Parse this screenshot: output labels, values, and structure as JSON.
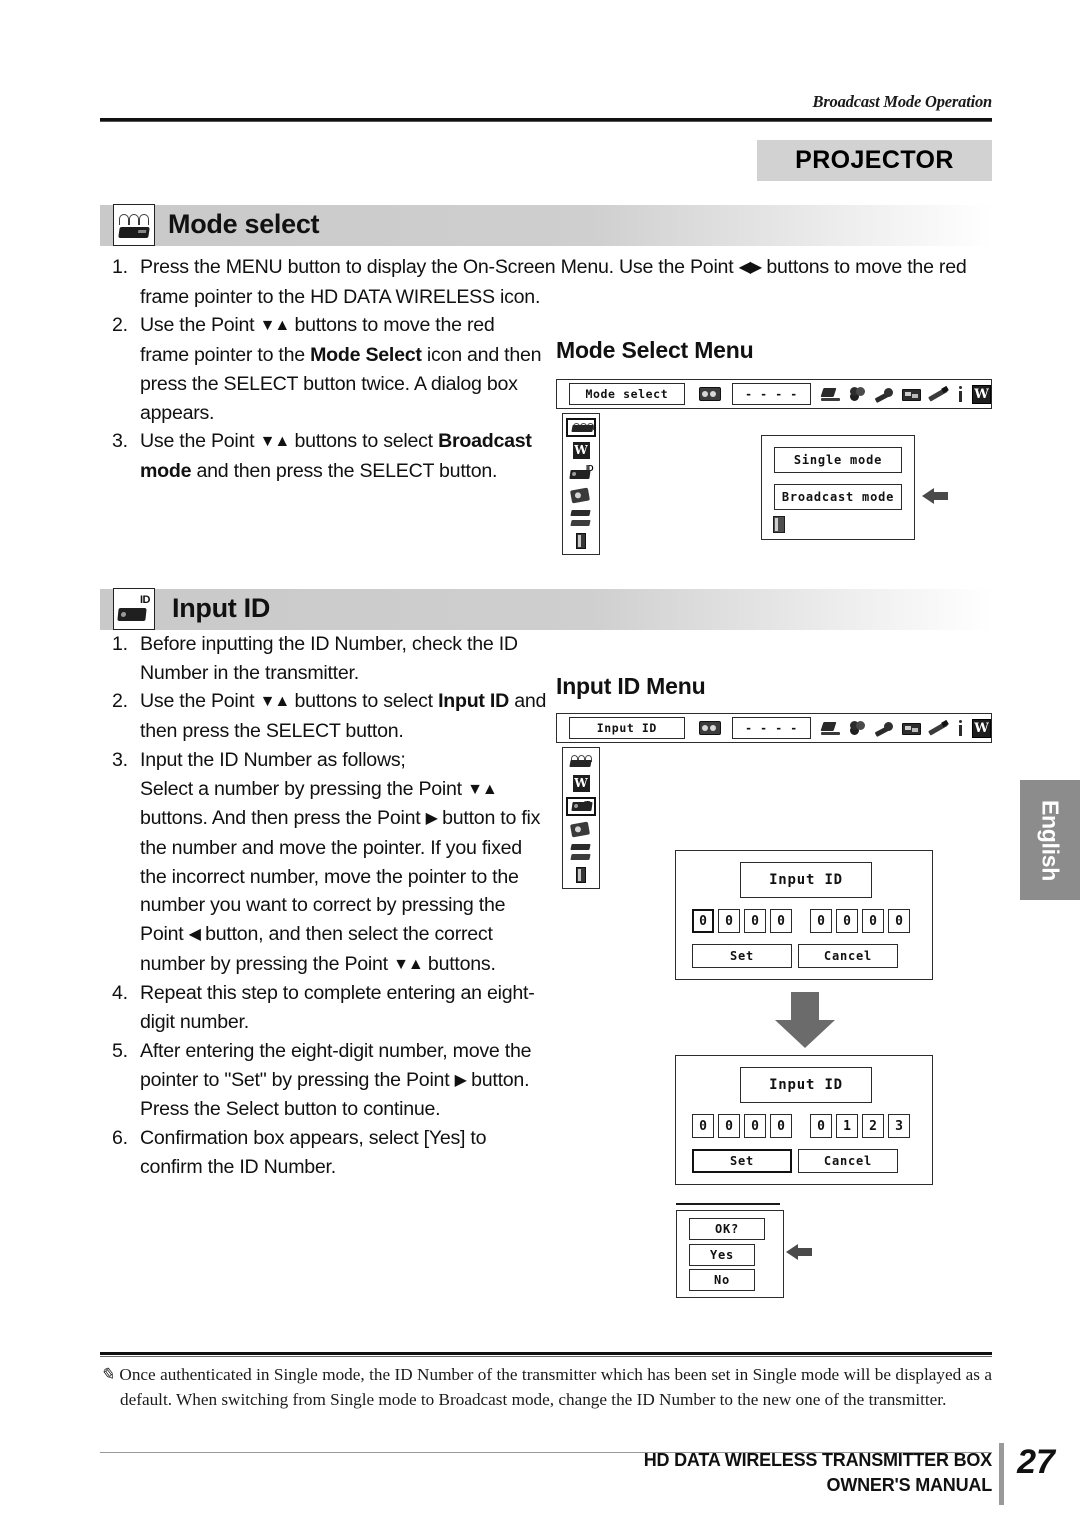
{
  "running_head": "Broadcast Mode Operation",
  "projector_tag": "PROJECTOR",
  "sections": [
    {
      "id": "mode-select",
      "icon": "wireless-transmitter-icon",
      "title": "Mode select",
      "steps": [
        {
          "num": "1.",
          "text": "Press the MENU button to display the On-Screen Menu. Use the Point ◀▶ buttons to move the red frame pointer to the HD DATA WIRELESS icon."
        },
        {
          "num": "2.",
          "text": "Use the Point ▼▲ buttons to move the red frame pointer to the Mode Select icon and then press the SELECT button twice. A dialog box appears."
        },
        {
          "num": "3.",
          "text": "Use the Point ▼▲ buttons to select Broadcast mode and then press the SELECT button."
        }
      ]
    },
    {
      "id": "input-id",
      "icon": "id-projector-icon",
      "title": "Input ID",
      "steps": [
        {
          "num": "1.",
          "text": "Before inputting the ID Number, check the ID Number in the transmitter."
        },
        {
          "num": "2.",
          "text": "Use the Point ▼▲ buttons to select Input ID and then press the SELECT button."
        },
        {
          "num": "3.",
          "text": "Input the ID Number as follows;"
        },
        {
          "num": "",
          "text": "Select a number by pressing the Point ▼▲ buttons. And then press the Point ▶ button to fix the number and move the pointer. If you fixed the incorrect number, move the pointer to the number you want to correct by pressing the Point ◀ button, and then select the correct number by pressing the Point ▼▲ buttons."
        },
        {
          "num": "4.",
          "text": "Repeat this step to complete entering an eight-digit number."
        },
        {
          "num": "5.",
          "text": "After entering the eight-digit number, move the pointer to \"Set\" by pressing the Point ▶ button. Press the Select button to continue."
        },
        {
          "num": "6.",
          "text": "Confirmation box appears, select [Yes] to confirm the ID Number."
        }
      ]
    }
  ],
  "mode_select_menu": {
    "caption": "Mode Select Menu",
    "osd_bar": {
      "field_label": "Mode select",
      "value": "- - - -",
      "icons": [
        "wireless-osd-icon",
        "laptop-icon",
        "color-adjust-icon",
        "image-adjust-icon",
        "screen-icon",
        "pencil-setting-icon",
        "info-icon",
        "w-logo-icon"
      ]
    },
    "sidebar_icons": [
      {
        "name": "wireless-transmitter-icon",
        "selected": true
      },
      {
        "name": "w-logo-icon",
        "selected": false
      },
      {
        "name": "id-projector-icon",
        "selected": false
      },
      {
        "name": "camera-icon",
        "selected": false
      },
      {
        "name": "stack-icon",
        "selected": false
      },
      {
        "name": "door-exit-icon",
        "selected": false
      }
    ],
    "dialog": {
      "options": [
        {
          "label": "Single mode",
          "pointed": false
        },
        {
          "label": "Broadcast mode",
          "pointed": true
        }
      ],
      "exit_icon": "door-exit-icon"
    }
  },
  "input_id_menu": {
    "caption": "Input ID Menu",
    "osd_bar": {
      "field_label": "Input ID",
      "value": "- - - -",
      "icons": [
        "wireless-osd-icon",
        "laptop-icon",
        "color-adjust-icon",
        "image-adjust-icon",
        "screen-icon",
        "pencil-setting-icon",
        "info-icon",
        "w-logo-icon"
      ]
    },
    "sidebar_icons": [
      {
        "name": "wireless-transmitter-icon",
        "selected": false
      },
      {
        "name": "w-logo-icon",
        "selected": false
      },
      {
        "name": "id-projector-icon",
        "selected": true
      },
      {
        "name": "camera-icon",
        "selected": false
      },
      {
        "name": "stack-icon",
        "selected": false
      },
      {
        "name": "door-exit-icon",
        "selected": false
      }
    ],
    "dialog_before": {
      "title": "Input ID",
      "digits_left": [
        "0",
        "0",
        "0",
        "0"
      ],
      "digits_right": [
        "0",
        "0",
        "0",
        "0"
      ],
      "highlight_index": 0,
      "set_label": "Set",
      "cancel_label": "Cancel",
      "highlight_button": ""
    },
    "dialog_after": {
      "title": "Input ID",
      "digits_left": [
        "0",
        "0",
        "0",
        "0"
      ],
      "digits_right": [
        "0",
        "1",
        "2",
        "3"
      ],
      "highlight_index": -1,
      "set_label": "Set",
      "cancel_label": "Cancel",
      "highlight_button": "Set"
    },
    "confirm_dialog": {
      "title": "OK?",
      "yes_label": "Yes",
      "no_label": "No",
      "pointed": "Yes"
    }
  },
  "side_tab": "English",
  "note": "Once authenticated in Single mode, the ID Number of the transmitter which has been set in Single mode will be displayed as a default. When switching from Single mode to Broadcast mode, change the ID Number to the new one of the transmitter.",
  "footer": {
    "line1": "HD DATA WIRELESS TRANSMITTER BOX",
    "line2": "OWNER'S MANUAL",
    "page": "27"
  }
}
